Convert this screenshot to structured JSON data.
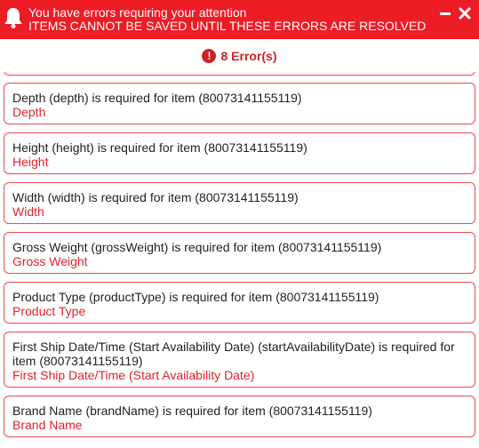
{
  "banner": {
    "title": "You have errors requiring your attention",
    "subtitle": "ITEMS CANNOT BE SAVED UNTIL THESE ERRORS ARE RESOLVED",
    "bg_color": "#ee1c25",
    "icons": [
      "bell-icon",
      "minimize-icon",
      "close-icon"
    ]
  },
  "error_count": {
    "icon": "!",
    "label": "8 Error(s)",
    "color": "#d01f27"
  },
  "errors": [
    {
      "message": "Depth (depth) is required for item (80073141155119)",
      "field": "Depth"
    },
    {
      "message": "Height (height) is required for item (80073141155119)",
      "field": "Height"
    },
    {
      "message": "Width (width) is required for item (80073141155119)",
      "field": "Width"
    },
    {
      "message": "Gross Weight (grossWeight) is required for item (80073141155119)",
      "field": "Gross Weight"
    },
    {
      "message": "Product Type (productType) is required for item (80073141155119)",
      "field": "Product Type"
    },
    {
      "message": "First Ship Date/Time (Start Availability Date) (startAvailabilityDate) is required for item (80073141155119)",
      "field": "First Ship Date/Time (Start Availability Date)"
    },
    {
      "message": "Brand Name (brandName) is required for item (80073141155119)",
      "field": "Brand Name"
    }
  ]
}
